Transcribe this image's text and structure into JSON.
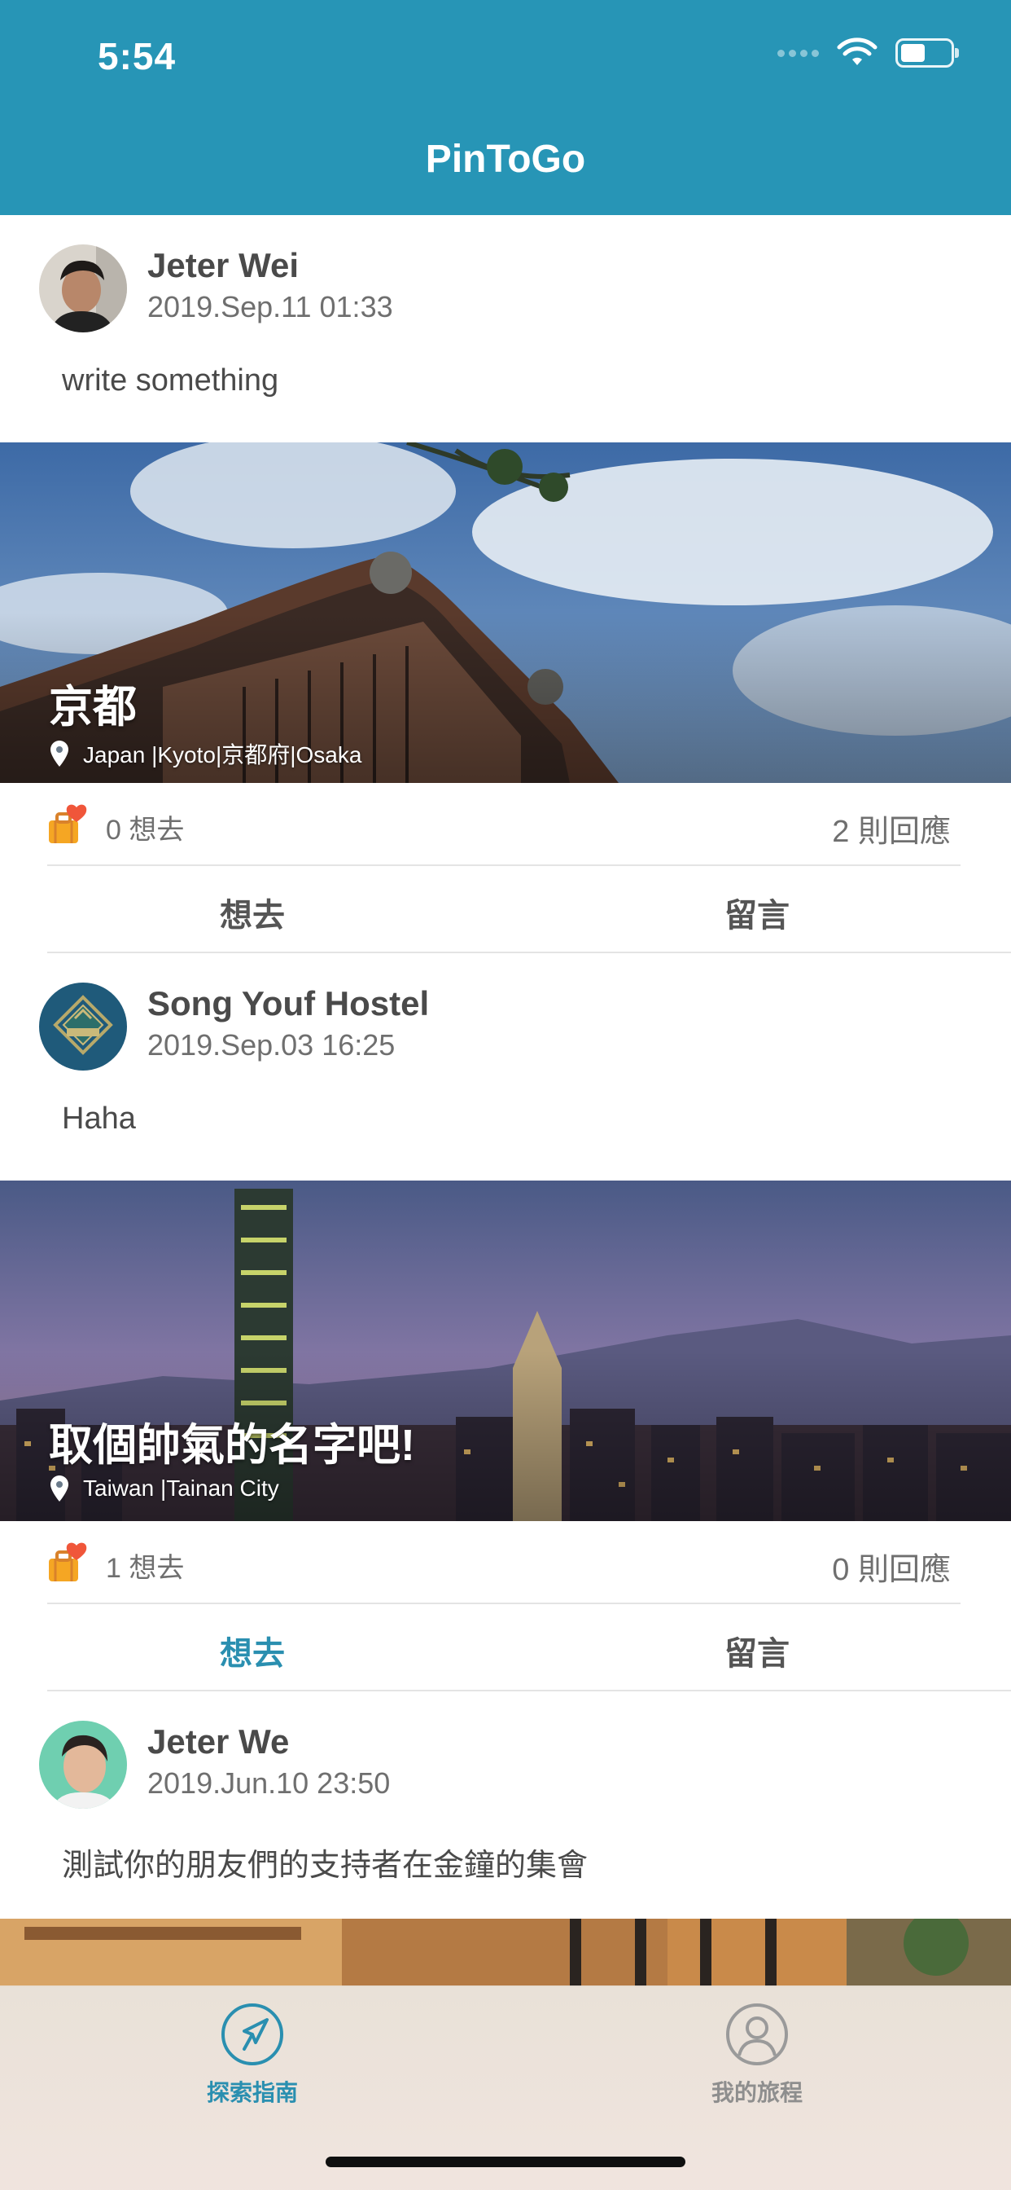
{
  "status_bar": {
    "time": "5:54"
  },
  "app": {
    "title": "PinToGo"
  },
  "posts": [
    {
      "author": "Jeter Wei",
      "date": "2019.Sep.11 01:33",
      "text": "write something",
      "trip_title": "京都",
      "trip_location": "Japan |Kyoto|京都府|Osaka",
      "want_count": "0 想去",
      "reply_count": "2 則回應",
      "want_active": false
    },
    {
      "author": "Song Youf Hostel",
      "date": "2019.Sep.03 16:25",
      "text": "Haha",
      "trip_title": "取個帥氣的名字吧!",
      "trip_location": "Taiwan |Tainan City",
      "want_count": "1 想去",
      "reply_count": "0 則回應",
      "want_active": true
    },
    {
      "author": "Jeter We",
      "date": "2019.Jun.10 23:50",
      "text": "測試你的朋友們的支持者在金鐘的集會"
    }
  ],
  "actions": {
    "want_label": "想去",
    "comment_label": "留言"
  },
  "tabbar": {
    "explore_label": "探索指南",
    "mytrip_label": "我的旅程"
  },
  "colors": {
    "header": "#2795b6",
    "accent": "#2a8fb0",
    "text": "#4a4a4a",
    "muted": "#6f6f6f"
  },
  "icons": [
    "location-pin-icon",
    "luggage-heart-icon",
    "navigation-arrow-icon",
    "person-icon",
    "wifi-icon",
    "battery-icon",
    "signal-icon"
  ]
}
